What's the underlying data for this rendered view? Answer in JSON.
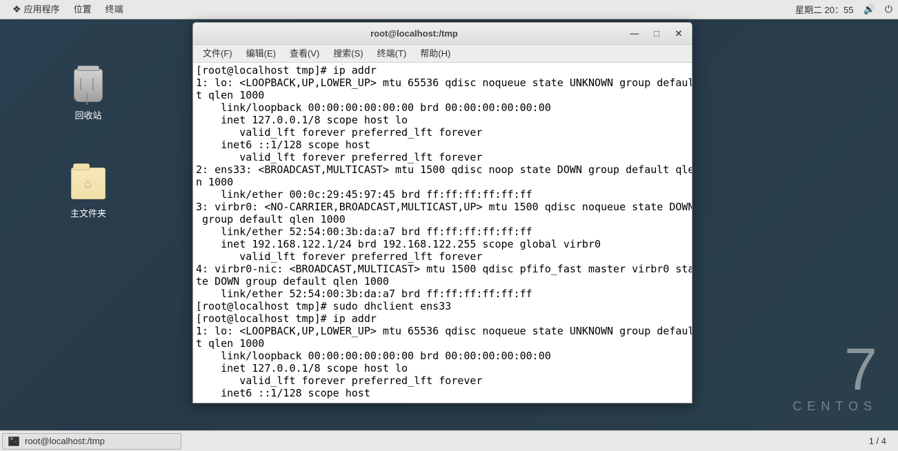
{
  "top_panel": {
    "apps": "应用程序",
    "places": "位置",
    "terminal": "终端",
    "clock": "星期二 20：55"
  },
  "desktop": {
    "trash_label": "回收站",
    "home_label": "主文件夹"
  },
  "terminal_window": {
    "title": "root@localhost:/tmp",
    "menu": {
      "file": "文件(F)",
      "edit": "编辑(E)",
      "view": "查看(V)",
      "search": "搜索(S)",
      "terminal": "终端(T)",
      "help": "帮助(H)"
    },
    "output": "[root@localhost tmp]# ip addr\n1: lo: <LOOPBACK,UP,LOWER_UP> mtu 65536 qdisc noqueue state UNKNOWN group defaul\nt qlen 1000\n    link/loopback 00:00:00:00:00:00 brd 00:00:00:00:00:00\n    inet 127.0.0.1/8 scope host lo\n       valid_lft forever preferred_lft forever\n    inet6 ::1/128 scope host\n       valid_lft forever preferred_lft forever\n2: ens33: <BROADCAST,MULTICAST> mtu 1500 qdisc noop state DOWN group default qle\nn 1000\n    link/ether 00:0c:29:45:97:45 brd ff:ff:ff:ff:ff:ff\n3: virbr0: <NO-CARRIER,BROADCAST,MULTICAST,UP> mtu 1500 qdisc noqueue state DOWN\n group default qlen 1000\n    link/ether 52:54:00:3b:da:a7 brd ff:ff:ff:ff:ff:ff\n    inet 192.168.122.1/24 brd 192.168.122.255 scope global virbr0\n       valid_lft forever preferred_lft forever\n4: virbr0-nic: <BROADCAST,MULTICAST> mtu 1500 qdisc pfifo_fast master virbr0 sta\nte DOWN group default qlen 1000\n    link/ether 52:54:00:3b:da:a7 brd ff:ff:ff:ff:ff:ff\n[root@localhost tmp]# sudo dhclient ens33\n[root@localhost tmp]# ip addr\n1: lo: <LOOPBACK,UP,LOWER_UP> mtu 65536 qdisc noqueue state UNKNOWN group defaul\nt qlen 1000\n    link/loopback 00:00:00:00:00:00 brd 00:00:00:00:00:00\n    inet 127.0.0.1/8 scope host lo\n       valid_lft forever preferred_lft forever\n    inet6 ::1/128 scope host"
  },
  "bottom_panel": {
    "task_label": "root@localhost:/tmp",
    "workspace": "1 / 4"
  },
  "brand": {
    "seven": "7",
    "name": "CENTOS"
  }
}
